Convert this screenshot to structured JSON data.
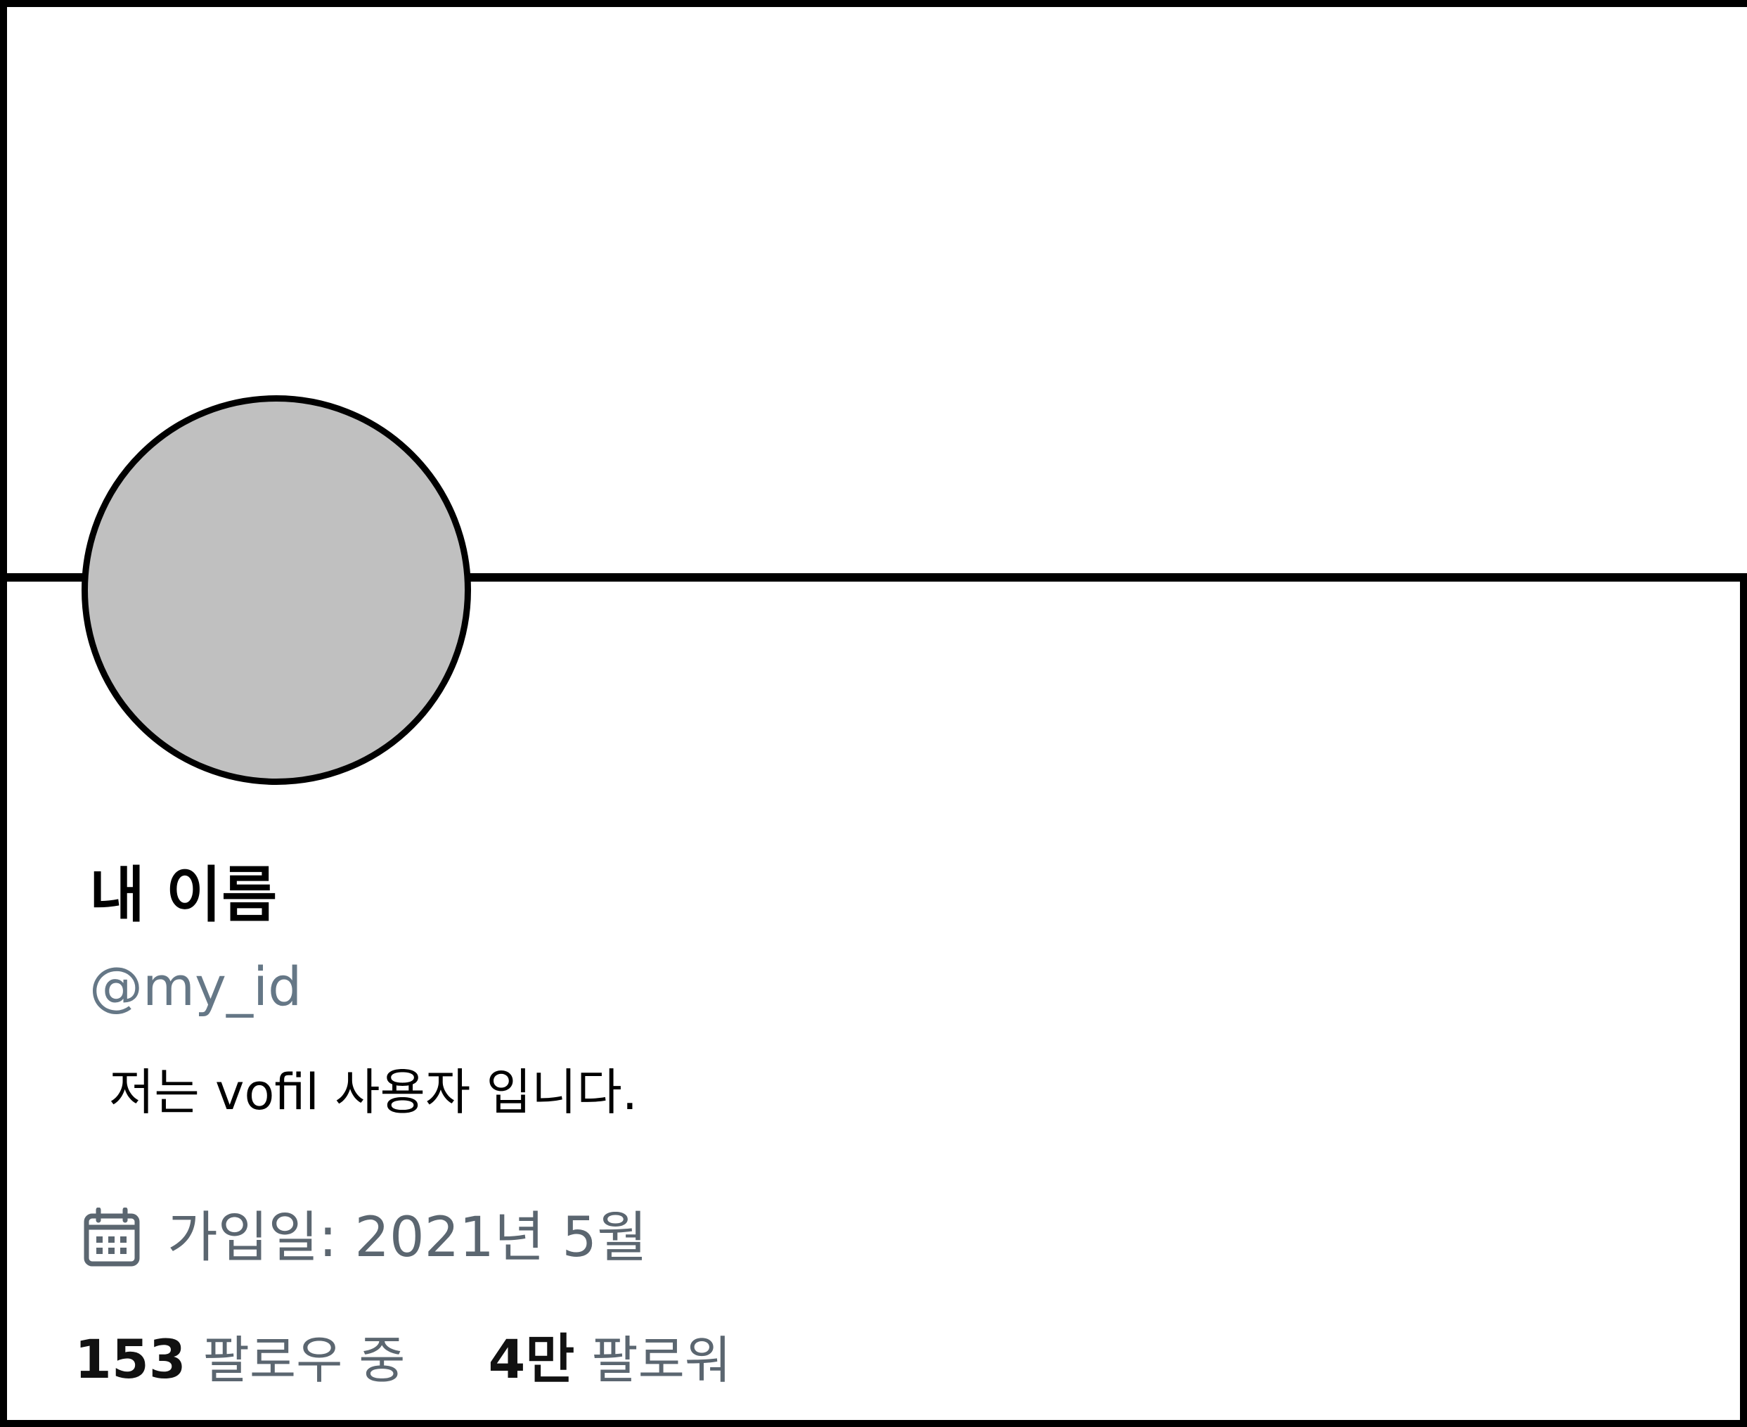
{
  "profile": {
    "display_name": "내 이름",
    "handle": "@my_id",
    "bio": "저는 vofil 사용자 입니다.",
    "joined": "가입일: 2021년 5월",
    "joined_icon": "calendar-icon",
    "avatar_color": "#c0c0c0",
    "secondary_text_color": "#657786"
  },
  "stats": {
    "following_count": "153",
    "following_label": "팔로우 중",
    "followers_count": "4만",
    "followers_label": "팔로워"
  }
}
